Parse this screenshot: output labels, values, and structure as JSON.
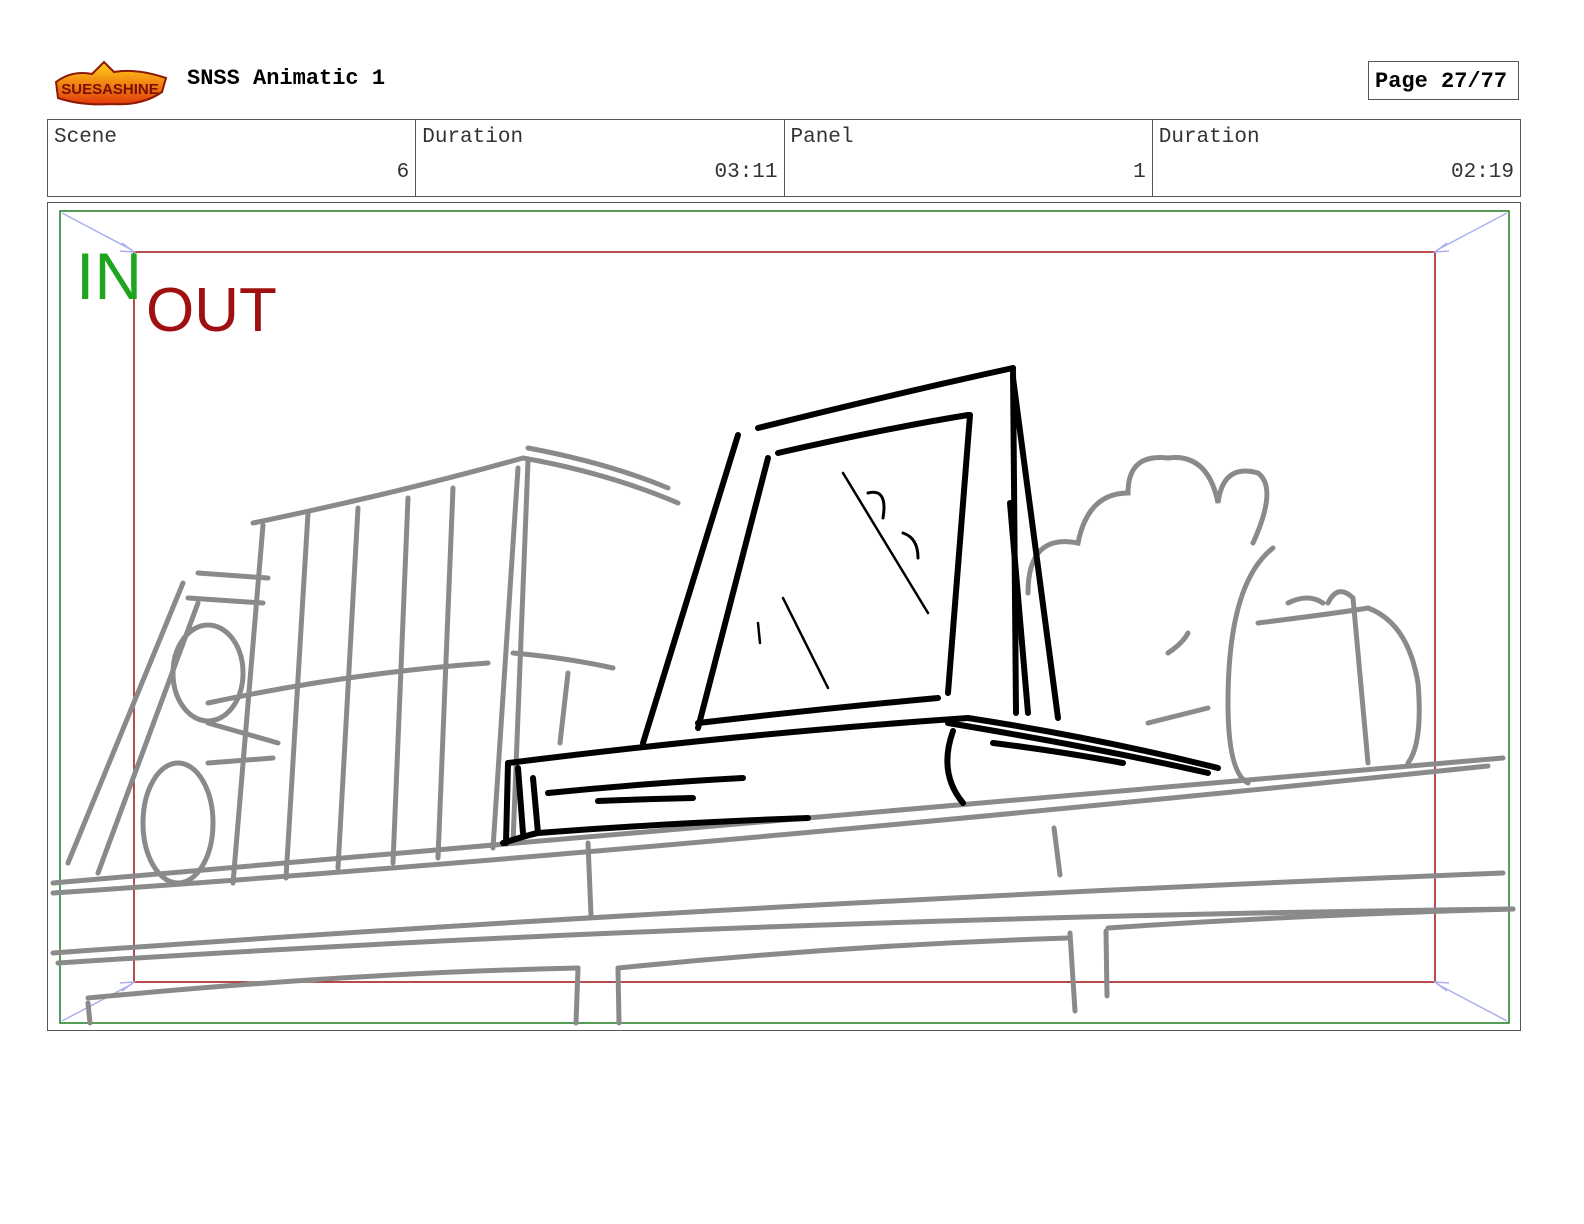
{
  "header": {
    "title": "SNSS Animatic 1",
    "page": "Page 27/77",
    "logo_text": "Sir Sue-Sa-Shine"
  },
  "info": {
    "scene_label": "Scene",
    "scene_value": "6",
    "scene_duration_label": "Duration",
    "scene_duration_value": "03:11",
    "panel_label": "Panel",
    "panel_value": "1",
    "panel_duration_label": "Duration",
    "panel_duration_value": "02:19"
  },
  "frame": {
    "in_label": "IN",
    "out_label": "OUT",
    "in_color": "#1fa51f",
    "out_color": "#a01010",
    "sketch_gray": "#8a8a8a",
    "sketch_black": "#000000"
  }
}
